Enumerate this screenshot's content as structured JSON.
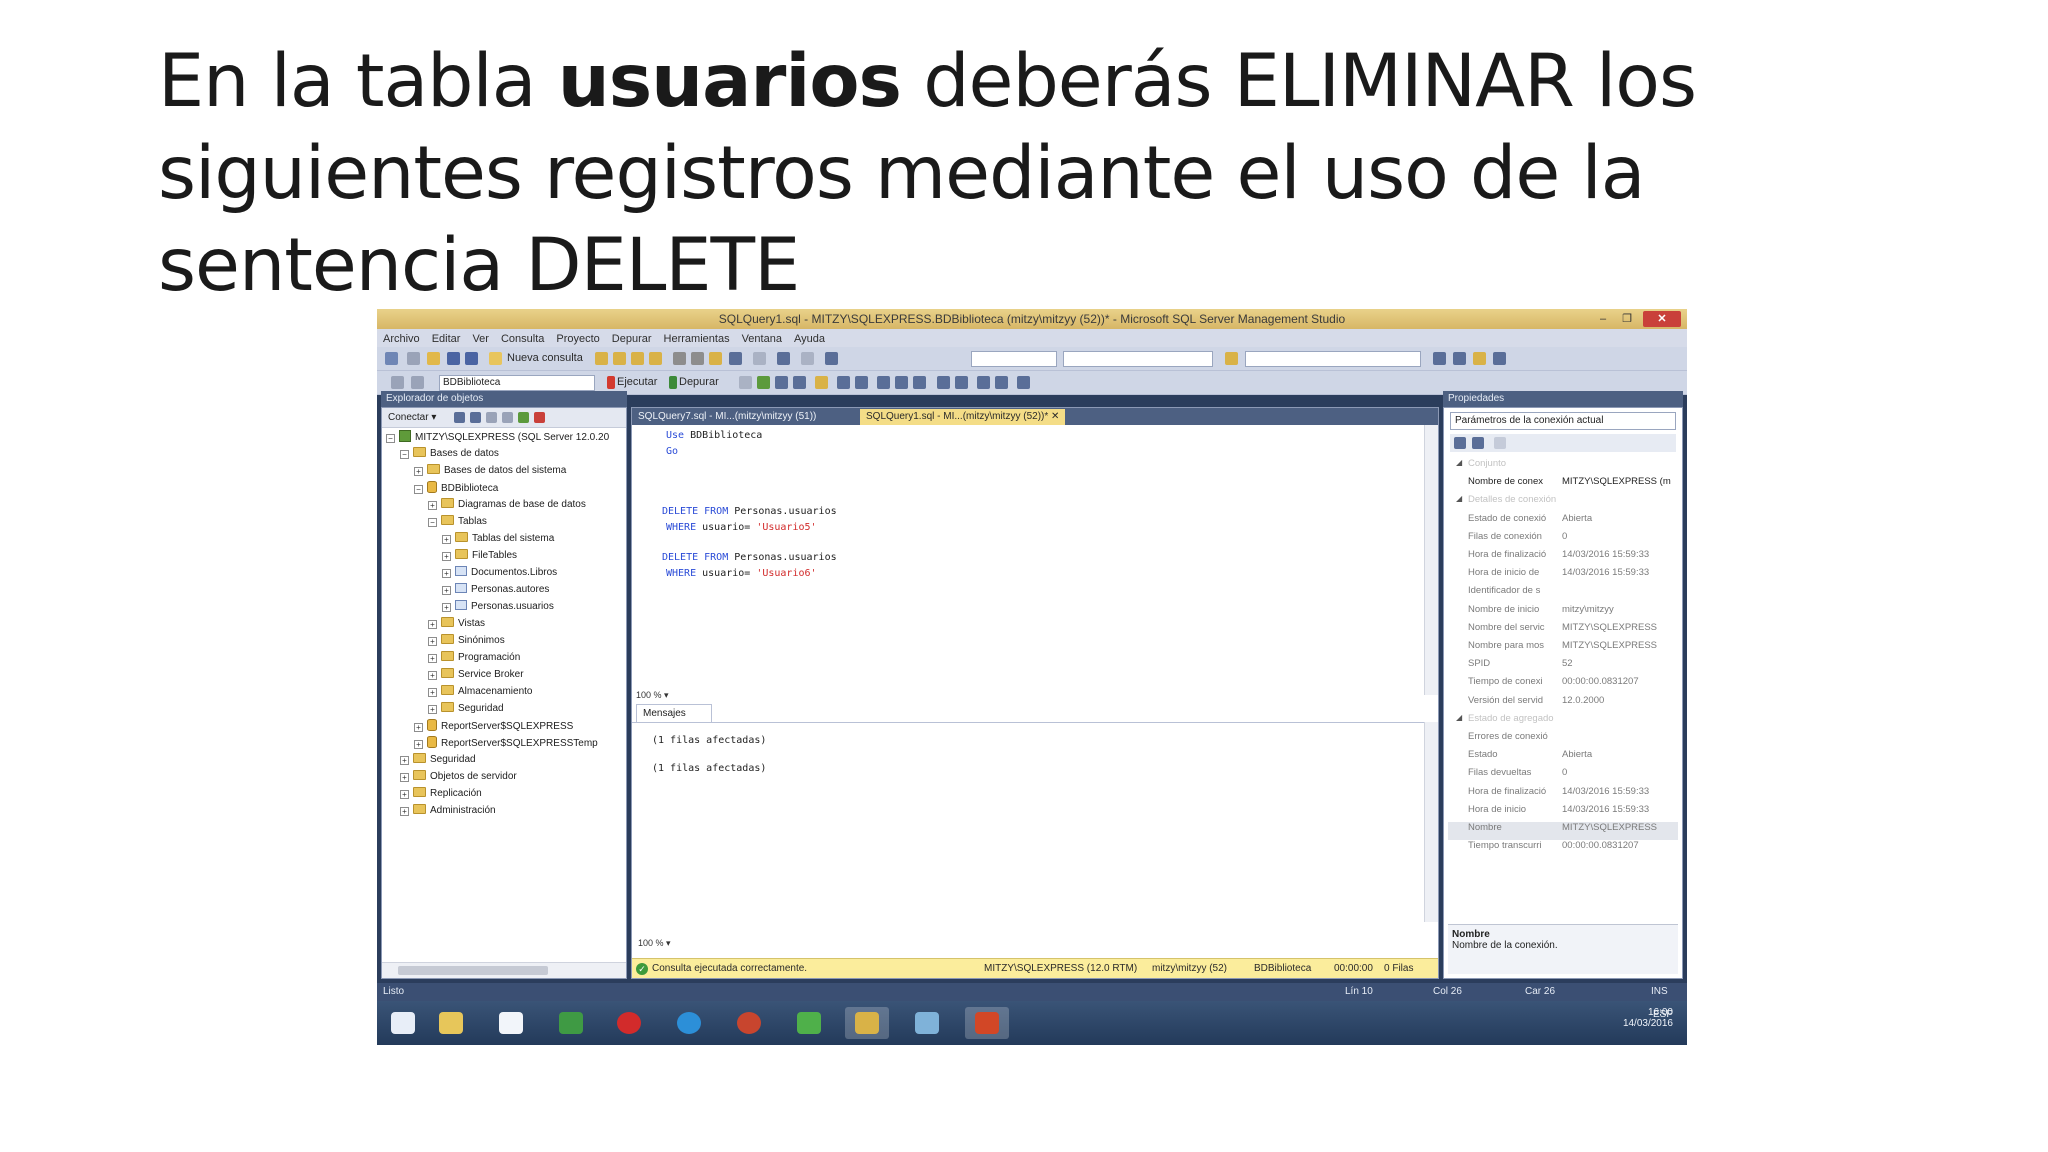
{
  "slide": {
    "title_pre": "En la tabla ",
    "title_bold": "usuarios",
    "title_post": " deberás ELIMINAR los siguientes registros mediante el uso de la sentencia DELETE"
  },
  "window": {
    "title": "SQLQuery1.sql - MITZY\\SQLEXPRESS.BDBiblioteca (mitzy\\mitzyy (52))* - Microsoft SQL Server Management Studio",
    "minimize": "–",
    "maximize": "❐",
    "close": "✕"
  },
  "menu": [
    "Archivo",
    "Editar",
    "Ver",
    "Consulta",
    "Proyecto",
    "Depurar",
    "Herramientas",
    "Ventana",
    "Ayuda"
  ],
  "toolbar": {
    "new_query": "Nueva consulta",
    "database": "BDBiblioteca",
    "execute": "Ejecutar",
    "debug": "Depurar"
  },
  "object_explorer": {
    "header": "Explorador de objetos",
    "connect": "Conectar ▾",
    "tree": [
      {
        "label": "MITZY\\SQLEXPRESS (SQL Server 12.0.20",
        "icon": "server-icon",
        "exp": "−"
      },
      {
        "label": "Bases de datos",
        "icon": "folder-icon",
        "exp": "−"
      },
      {
        "label": "Bases de datos del sistema",
        "icon": "folder-icon",
        "exp": "+"
      },
      {
        "label": "BDBiblioteca",
        "icon": "database-icon",
        "exp": "−"
      },
      {
        "label": "Diagramas de base de datos",
        "icon": "folder-icon",
        "exp": "+"
      },
      {
        "label": "Tablas",
        "icon": "folder-icon",
        "exp": "−"
      },
      {
        "label": "Tablas del sistema",
        "icon": "folder-icon",
        "exp": "+"
      },
      {
        "label": "FileTables",
        "icon": "folder-icon",
        "exp": "+"
      },
      {
        "label": "Documentos.Libros",
        "icon": "table-icon",
        "exp": "+"
      },
      {
        "label": "Personas.autores",
        "icon": "table-icon",
        "exp": "+"
      },
      {
        "label": "Personas.usuarios",
        "icon": "table-icon",
        "exp": "+"
      },
      {
        "label": "Vistas",
        "icon": "folder-icon",
        "exp": "+"
      },
      {
        "label": "Sinónimos",
        "icon": "folder-icon",
        "exp": "+"
      },
      {
        "label": "Programación",
        "icon": "folder-icon",
        "exp": "+"
      },
      {
        "label": "Service Broker",
        "icon": "folder-icon",
        "exp": "+"
      },
      {
        "label": "Almacenamiento",
        "icon": "folder-icon",
        "exp": "+"
      },
      {
        "label": "Seguridad",
        "icon": "folder-icon",
        "exp": "+"
      },
      {
        "label": "ReportServer$SQLEXPRESS",
        "icon": "database-icon",
        "exp": "+"
      },
      {
        "label": "ReportServer$SQLEXPRESSTemp",
        "icon": "database-icon",
        "exp": "+"
      },
      {
        "label": "Seguridad",
        "icon": "folder-icon",
        "exp": "+"
      },
      {
        "label": "Objetos de servidor",
        "icon": "folder-icon",
        "exp": "+"
      },
      {
        "label": "Replicación",
        "icon": "folder-icon",
        "exp": "+"
      },
      {
        "label": "Administración",
        "icon": "folder-icon",
        "exp": "+"
      }
    ]
  },
  "tabs": [
    {
      "label": "SQLQuery7.sql - MI...(mitzy\\mitzyy (51))",
      "active": false
    },
    {
      "label": "SQLQuery1.sql - MI...(mitzy\\mitzyy (52))*",
      "active": true
    }
  ],
  "tab_close": "✕",
  "code": {
    "l1_kw": "Use",
    "l1_rest": " BDBiblioteca",
    "l2_kw": "Go",
    "q1_kw1": "DELETE FROM",
    "q1_rest": " Personas.usuarios",
    "q1_kw2": "WHERE",
    "q1_mid": " usuario= ",
    "q1_str": "'Usuario5'",
    "q2_kw1": "DELETE FROM",
    "q2_rest": " Personas.usuarios",
    "q2_kw2": "WHERE",
    "q2_mid": " usuario= ",
    "q2_str": "'Usuario6'"
  },
  "zoom": "100 %",
  "zoom_arrow": "▾",
  "messages_tab": "Mensajes",
  "messages": [
    "(1 filas afectadas)",
    "(1 filas afectadas)"
  ],
  "query_status": {
    "ok": "Consulta ejecutada correctamente.",
    "server": "MITZY\\SQLEXPRESS (12.0 RTM)",
    "user": "mitzy\\mitzyy (52)",
    "db": "BDBiblioteca",
    "time": "00:00:00",
    "rows": "0 Filas"
  },
  "properties": {
    "header": "Propiedades",
    "combo": "Parámetros de la conexión actual",
    "rows": [
      {
        "cat": true,
        "name": "Conjunto"
      },
      {
        "cat": false,
        "strong": true,
        "name": "Nombre de conex",
        "value": "MITZY\\SQLEXPRESS (m"
      },
      {
        "cat": true,
        "name": "Detalles de conexión"
      },
      {
        "cat": false,
        "name": "Estado de conexió",
        "value": "Abierta"
      },
      {
        "cat": false,
        "name": "Filas de conexión",
        "value": "0"
      },
      {
        "cat": false,
        "name": "Hora de finalizació",
        "value": "14/03/2016 15:59:33"
      },
      {
        "cat": false,
        "name": "Hora de inicio de",
        "value": "14/03/2016 15:59:33"
      },
      {
        "cat": false,
        "name": "Identificador de s",
        "value": ""
      },
      {
        "cat": false,
        "name": "Nombre de inicio",
        "value": "mitzy\\mitzyy"
      },
      {
        "cat": false,
        "name": "Nombre del servic",
        "value": "MITZY\\SQLEXPRESS"
      },
      {
        "cat": false,
        "name": "Nombre para mos",
        "value": "MITZY\\SQLEXPRESS"
      },
      {
        "cat": false,
        "name": "SPID",
        "value": "52"
      },
      {
        "cat": false,
        "name": "Tiempo de conexi",
        "value": "00:00:00.0831207"
      },
      {
        "cat": false,
        "name": "Versión del servid",
        "value": "12.0.2000"
      },
      {
        "cat": true,
        "name": "Estado de agregado"
      },
      {
        "cat": false,
        "name": "Errores de conexió",
        "value": ""
      },
      {
        "cat": false,
        "name": "Estado",
        "value": "Abierta"
      },
      {
        "cat": false,
        "name": "Filas devueltas",
        "value": "0"
      },
      {
        "cat": false,
        "name": "Hora de finalizació",
        "value": "14/03/2016 15:59:33"
      },
      {
        "cat": false,
        "name": "Hora de inicio",
        "value": "14/03/2016 15:59:33"
      },
      {
        "cat": false,
        "sel": true,
        "name": "Nombre",
        "value": "MITZY\\SQLEXPRESS"
      },
      {
        "cat": false,
        "name": "Tiempo transcurri",
        "value": "00:00:00.0831207"
      }
    ],
    "desc_title": "Nombre",
    "desc_text": "Nombre de la conexión."
  },
  "app_status": {
    "ready": "Listo",
    "ln": "Lín 10",
    "col": "Col 26",
    "car": "Car 26",
    "ins": "INS"
  },
  "tray": {
    "lang": "ESP",
    "time": "16:00",
    "date": "14/03/2016"
  }
}
